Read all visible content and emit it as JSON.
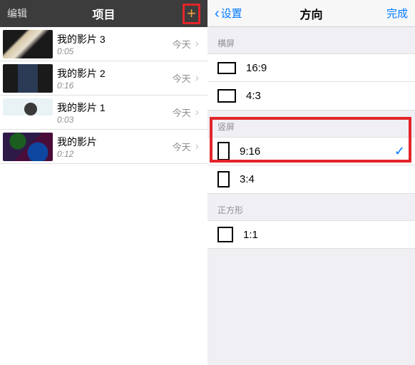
{
  "left": {
    "nav": {
      "edit": "编辑",
      "title": "项目",
      "plus": "+"
    },
    "projects": [
      {
        "name": "我的影片 3",
        "duration": "0:05",
        "date": "今天"
      },
      {
        "name": "我的影片 2",
        "duration": "0:16",
        "date": "今天"
      },
      {
        "name": "我的影片 1",
        "duration": "0:03",
        "date": "今天"
      },
      {
        "name": "我的影片",
        "duration": "0:12",
        "date": "今天"
      }
    ]
  },
  "right": {
    "nav": {
      "back": "设置",
      "title": "方向",
      "done": "完成"
    },
    "sections": {
      "landscape": {
        "header": "横屏",
        "options": [
          {
            "label": "16:9"
          },
          {
            "label": "4:3"
          }
        ]
      },
      "portrait": {
        "header": "竖屏",
        "options": [
          {
            "label": "9:16",
            "selected": true
          },
          {
            "label": "3:4"
          }
        ]
      },
      "square": {
        "header": "正方形",
        "options": [
          {
            "label": "1:1"
          }
        ]
      }
    }
  }
}
